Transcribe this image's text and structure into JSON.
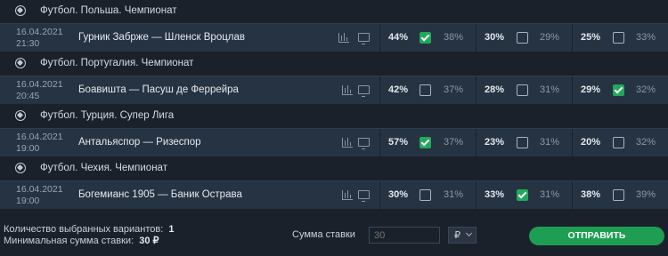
{
  "leagues": [
    {
      "name": "Футбол. Польша. Чемпионат",
      "match": {
        "date": "16.04.2021",
        "time": "21:30",
        "teams": "Гурник Забрже — Шленск Вроцлав",
        "outcomes": [
          {
            "main": "44%",
            "checked": true,
            "alt": "38%"
          },
          {
            "main": "30%",
            "checked": false,
            "alt": "29%"
          },
          {
            "main": "25%",
            "checked": false,
            "alt": "33%"
          }
        ]
      }
    },
    {
      "name": "Футбол. Португалия. Чемпионат",
      "match": {
        "date": "16.04.2021",
        "time": "20:45",
        "teams": "Боавишта — Пасуш де Феррейра",
        "outcomes": [
          {
            "main": "42%",
            "checked": false,
            "alt": "37%"
          },
          {
            "main": "28%",
            "checked": false,
            "alt": "31%"
          },
          {
            "main": "29%",
            "checked": true,
            "alt": "32%"
          }
        ]
      }
    },
    {
      "name": "Футбол. Турция. Супер Лига",
      "match": {
        "date": "16.04.2021",
        "time": "19:00",
        "teams": "Антальяспор — Ризеспор",
        "outcomes": [
          {
            "main": "57%",
            "checked": true,
            "alt": "37%"
          },
          {
            "main": "23%",
            "checked": false,
            "alt": "31%"
          },
          {
            "main": "20%",
            "checked": false,
            "alt": "32%"
          }
        ]
      }
    },
    {
      "name": "Футбол. Чехия. Чемпионат",
      "match": {
        "date": "16.04.2021",
        "time": "19:00",
        "teams": "Богемианс 1905 — Баник Острава",
        "outcomes": [
          {
            "main": "30%",
            "checked": false,
            "alt": "31%"
          },
          {
            "main": "33%",
            "checked": true,
            "alt": "31%"
          },
          {
            "main": "38%",
            "checked": false,
            "alt": "39%"
          }
        ]
      }
    }
  ],
  "footer": {
    "selected_label": "Количество выбранных вариантов:",
    "selected_value": "1",
    "min_label": "Минимальная сумма ставки:",
    "min_value": "30 ₽",
    "stake_label": "Сумма ставки",
    "stake_placeholder": "30",
    "currency": "₽",
    "submit_label": "ОТПРАВИТЬ"
  },
  "colors": {
    "background": "#1b212b",
    "row": "#263342",
    "accent": "#1d9e52"
  },
  "icons": [
    "football-icon",
    "stats-icon",
    "tv-icon",
    "checkbox-icon",
    "chevron-down-icon"
  ]
}
